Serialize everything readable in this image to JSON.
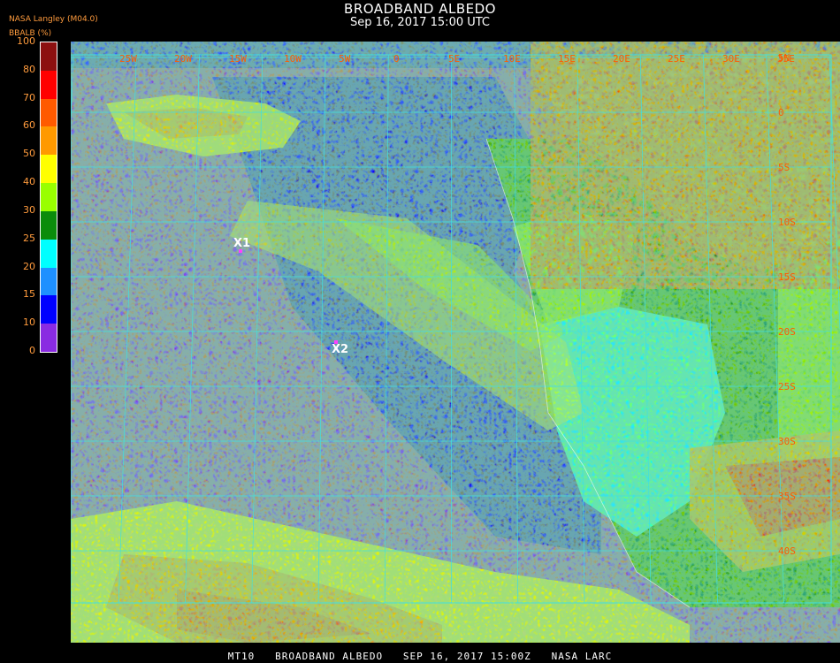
{
  "header": {
    "title": "BROADBAND ALBEDO",
    "subtitle": "Sep 16, 2017 15:00 UTC",
    "source": "NASA Langley (M04.0)",
    "variable_label": "BBALB (%)"
  },
  "colorbar": {
    "ticks": [
      "100",
      "80",
      "70",
      "60",
      "50",
      "40",
      "30",
      "25",
      "20",
      "15",
      "10",
      "0"
    ],
    "colors": [
      "#8c1010",
      "#ff0000",
      "#ff5a00",
      "#ff9900",
      "#ffff00",
      "#99ff00",
      "#0b8c0b",
      "#00ffff",
      "#1e90ff",
      "#0000ff",
      "#8a2be2"
    ]
  },
  "map": {
    "grid_color": "#40e0e0",
    "lon_labels": [
      "25W",
      "20W",
      "15W",
      "10W",
      "5W",
      "0",
      "5E",
      "10E",
      "15E",
      "20E",
      "25E",
      "30E",
      "35E"
    ],
    "lat_labels": [
      "5N",
      "0",
      "5S",
      "10S",
      "15S",
      "20S",
      "25S",
      "30S",
      "35S",
      "40S"
    ]
  },
  "markers": [
    {
      "label": "X1"
    },
    {
      "label": "X2"
    }
  ],
  "footer": {
    "text": "MT10   BROADBAND ALBEDO   SEP 16, 2017 15:00Z   NASA LARC"
  }
}
